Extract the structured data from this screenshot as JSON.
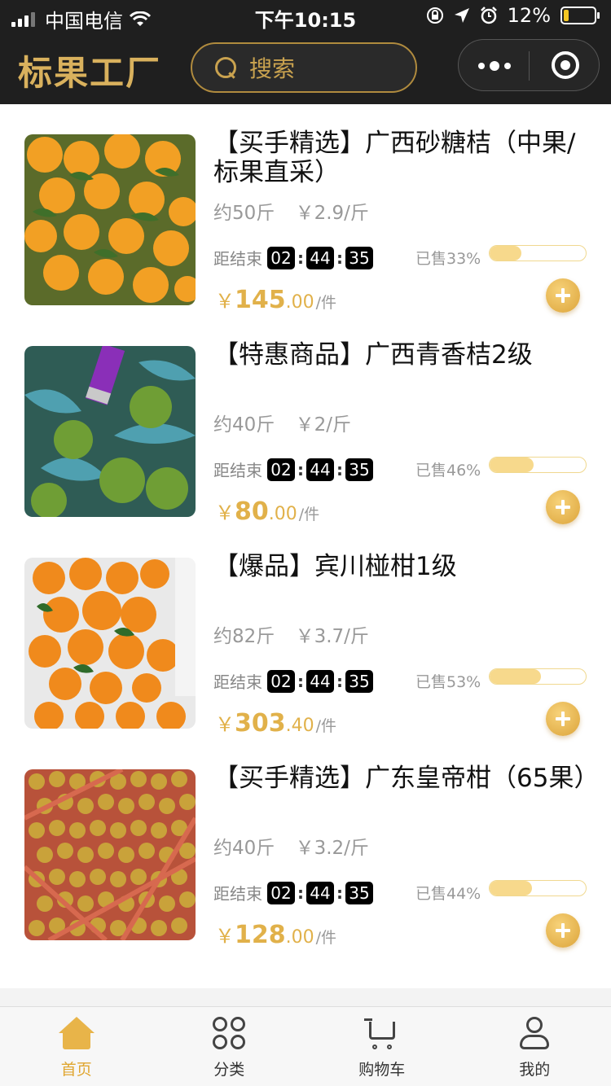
{
  "status_bar": {
    "carrier": "中国电信",
    "time": "下午10:15",
    "battery": "12%"
  },
  "nav": {
    "logo": "标果工厂",
    "search_placeholder": "搜索"
  },
  "products": [
    {
      "title": "【买手精选】广西砂糖桔（中果/标果直采）",
      "weight": "约50斤",
      "unit_price": "￥2.9/斤",
      "countdown_label": "距结束",
      "countdown": [
        "02",
        "44",
        "35"
      ],
      "sold_text": "已售33%",
      "sold_fraction": 0.33,
      "currency": "￥",
      "price_int": "145",
      "price_dec": ".00",
      "price_unit": "/件"
    },
    {
      "title": "【特惠商品】广西青香桔2级",
      "weight": "约40斤",
      "unit_price": "￥2/斤",
      "countdown_label": "距结束",
      "countdown": [
        "02",
        "44",
        "35"
      ],
      "sold_text": "已售46%",
      "sold_fraction": 0.46,
      "currency": "￥",
      "price_int": "80",
      "price_dec": ".00",
      "price_unit": "/件"
    },
    {
      "title": "【爆品】宾川椪柑1级",
      "weight": "约82斤",
      "unit_price": "￥3.7/斤",
      "countdown_label": "距结束",
      "countdown": [
        "02",
        "44",
        "35"
      ],
      "sold_text": "已售53%",
      "sold_fraction": 0.53,
      "currency": "￥",
      "price_int": "303",
      "price_dec": ".40",
      "price_unit": "/件"
    },
    {
      "title": "【买手精选】广东皇帝柑（65果）",
      "weight": "约40斤",
      "unit_price": "￥3.2/斤",
      "countdown_label": "距结束",
      "countdown": [
        "02",
        "44",
        "35"
      ],
      "sold_text": "已售44%",
      "sold_fraction": 0.44,
      "currency": "￥",
      "price_int": "128",
      "price_dec": ".00",
      "price_unit": "/件"
    }
  ],
  "tabbar": [
    {
      "label": "首页",
      "icon": "home-icon",
      "active": true
    },
    {
      "label": "分类",
      "icon": "category-icon",
      "active": false
    },
    {
      "label": "购物车",
      "icon": "cart-icon",
      "active": false
    },
    {
      "label": "我的",
      "icon": "user-icon",
      "active": false
    }
  ],
  "colors": {
    "accent": "#e0a630",
    "price": "#e1b14a",
    "header_bg": "#1f1f1f",
    "progress_fill": "#f7d98c"
  }
}
